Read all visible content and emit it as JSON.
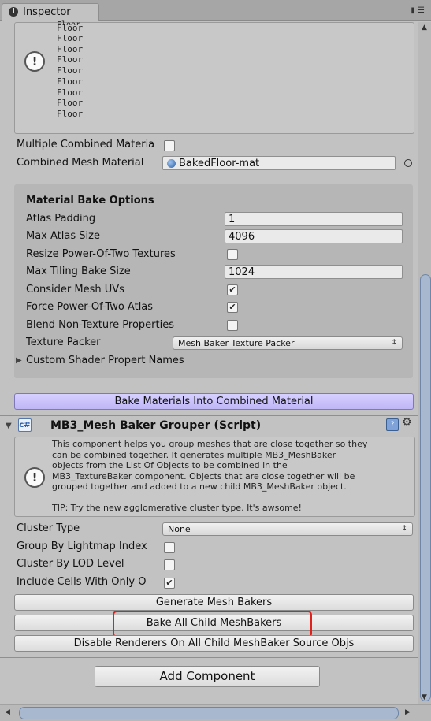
{
  "tab": {
    "icon": "info-icon",
    "label": "Inspector"
  },
  "top_help": {
    "lines": [
      "Floor",
      "Floor",
      "Floor",
      "Floor",
      "Floor",
      "Floor",
      "Floor",
      "Floor",
      "Floor"
    ],
    "partial": "Floor"
  },
  "props": {
    "multi_label": "Multiple Combined Materia",
    "combined_label": "Combined Mesh Material",
    "combined_value": "BakedFloor-mat"
  },
  "material_bake": {
    "title": "Material Bake Options",
    "atlas_padding_label": "Atlas Padding",
    "atlas_padding_value": "1",
    "max_atlas_label": "Max Atlas Size",
    "max_atlas_value": "4096",
    "resize_label": "Resize Power-Of-Two Textures",
    "max_tiling_label": "Max Tiling Bake Size",
    "max_tiling_value": "1024",
    "consider_uvs_label": "Consider Mesh UVs",
    "force_pow2_label": "Force Power-Of-Two Atlas",
    "blend_label": "Blend Non-Texture Properties",
    "packer_label": "Texture Packer",
    "packer_value": "Mesh Baker Texture Packer",
    "custom_shader_label": "Custom Shader Propert Names"
  },
  "bake_materials_button": "Bake Materials Into Combined Material",
  "grouper": {
    "title": "MB3_Mesh Baker Grouper (Script)",
    "help_lines": [
      "This component helps you group meshes that are close together so they",
      "can be combined together. It generates multiple MB3_MeshBaker",
      "objects from the List Of Objects to be combined in the",
      "MB3_TextureBaker component. Objects that are close together will be",
      "grouped together and added to a new child MB3_MeshBaker object.",
      "",
      "TIP: Try the new agglomerative cluster type. It's awsome!"
    ],
    "cluster_type_label": "Cluster Type",
    "cluster_type_value": "None",
    "lightmap_label": "Group By Lightmap Index",
    "lod_label": "Cluster By LOD Level",
    "cells_label": "Include Cells With Only O",
    "generate_button": "Generate Mesh Bakers",
    "bake_child_button": "Bake All Child MeshBakers",
    "disable_button": "Disable Renderers On All Child MeshBaker Source Objs"
  },
  "add_component_button": "Add Component"
}
